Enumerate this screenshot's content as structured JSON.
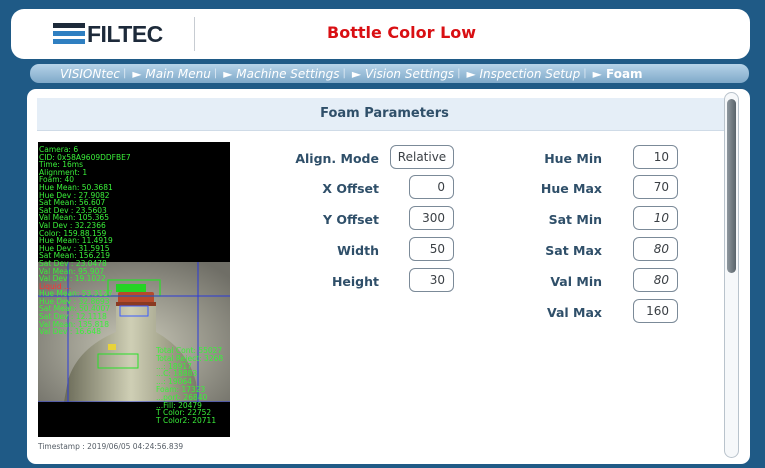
{
  "header": {
    "logo_text": "FILTEC",
    "alert_title": "Bottle Color Low"
  },
  "breadcrumb": {
    "items": [
      "VISIONtec",
      "► Main Menu",
      "► Machine Settings",
      "► Vision Settings",
      "► Inspection Setup"
    ],
    "current": "► Foam"
  },
  "panel": {
    "title": "Foam Parameters"
  },
  "camera": {
    "overlay_lines": [
      "Camera: 6",
      "CID: 0x58A9609DDFBE7",
      "Time: 16ms",
      "Alignment: 1",
      "Foam: 40",
      "Hue Mean: 50.3681",
      "Hue Dev : 27.9082",
      "Sat Mean: 56.607",
      "Sat Dev : 23.5603",
      "Val Mean: 105.365",
      "Val Dev : 32.2366",
      "Color: 159.88.159",
      "Hue Mean: 11.4919",
      "Hue Dev : 31.5915",
      "Sat Mean: 156.219",
      "Sat Dev : 23.0478",
      "Val Mean: 95.907",
      "Val Dev : 19.1022",
      "Liquid ...",
      "Hue Mean: 53.3127",
      "Hue Dev : 32.8693",
      "Sat Mean: 50.4007",
      "Sat Dev : 12.1118",
      "Val Mean: 135.818",
      "Val Dev : 16.648"
    ],
    "stats_lines": [
      "Total Cont: 55027",
      "Total Reject: 3268",
      "...: 18917",
      "...C: 18883",
      "...: 19064",
      "Foam: 17323",
      "...port: 26840",
      "...Fill: 20479",
      "T Color: 22752",
      "T Color2: 20711"
    ],
    "timestamp": "Timestamp : 2019/06/05 04:24:56.839"
  },
  "params_left": [
    {
      "label": "Align. Mode",
      "value": "Relative"
    },
    {
      "label": "X Offset",
      "value": "0"
    },
    {
      "label": "Y Offset",
      "value": "300"
    },
    {
      "label": "Width",
      "value": "50"
    },
    {
      "label": "Height",
      "value": "30"
    }
  ],
  "params_right": [
    {
      "label": "Hue Min",
      "value": "10"
    },
    {
      "label": "Hue Max",
      "value": "70"
    },
    {
      "label": "Sat Min",
      "value": "10"
    },
    {
      "label": "Sat Max",
      "value": "80"
    },
    {
      "label": "Val Min",
      "value": "80"
    },
    {
      "label": "Val Max",
      "value": "160"
    }
  ],
  "colors": {
    "background": "#1f5a86",
    "alert": "#d90f13",
    "label": "#2f4f69",
    "overlay_text": "#3af03a"
  }
}
